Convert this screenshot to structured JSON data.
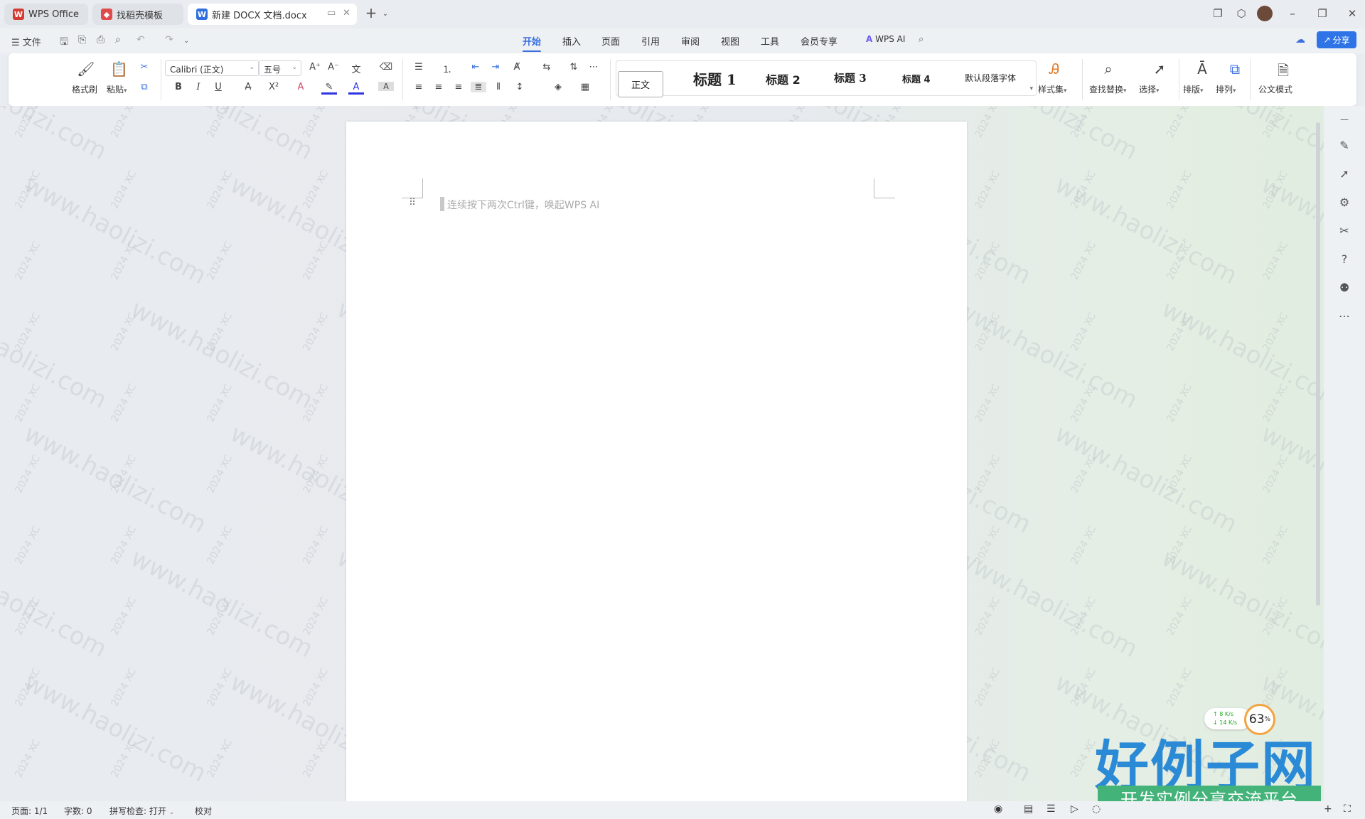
{
  "tabs": [
    {
      "label": "WPS Office",
      "icon": "wps-logo-icon",
      "color": "#d43b32"
    },
    {
      "label": "找稻壳模板",
      "icon": "docer-icon",
      "color": "#e04a4a"
    },
    {
      "label": "新建 DOCX 文档.docx",
      "icon": "word-doc-icon",
      "color": "#2f6fde"
    }
  ],
  "menu": {
    "file_label": "文件",
    "items": [
      "开始",
      "插入",
      "页面",
      "引用",
      "审阅",
      "视图",
      "工具",
      "会员专享"
    ],
    "active": "开始",
    "wps_ai": "WPS AI",
    "share": "分享"
  },
  "ribbon": {
    "format_painter": "格式刷",
    "paste": "粘贴",
    "font_name": "Calibri (正文)",
    "font_size": "五号",
    "styles": [
      "正文",
      "标题 1",
      "标题 2",
      "标题 3",
      "标题 4",
      "默认段落字体"
    ],
    "style_set": "样式集",
    "find_replace": "查找替换",
    "select": "选择",
    "layout": "排版",
    "arrange": "排列",
    "official_mode": "公文模式"
  },
  "document": {
    "ai_hint": "连续按下两次Ctrl键，唤起WPS AI"
  },
  "watermark": {
    "text": "www.haolizi.com",
    "tag": "2024 XC"
  },
  "status": {
    "page": "页面: 1/1",
    "words": "字数: 0",
    "spellcheck": "拼写检查: 打开",
    "proofread": "校对"
  },
  "network_widget": {
    "up": "8",
    "down": "14",
    "unit": "K/s",
    "cpu": "63",
    "cpu_unit": "%"
  },
  "overlay_logo": {
    "title": "好例子网",
    "subtitle": "开发实例分享交流平台"
  },
  "colors": {
    "accent": "#3a6fe0",
    "share_bg": "#2f74e6",
    "logo_blue": "#2a8ad6",
    "logo_green": "#44b37a"
  }
}
